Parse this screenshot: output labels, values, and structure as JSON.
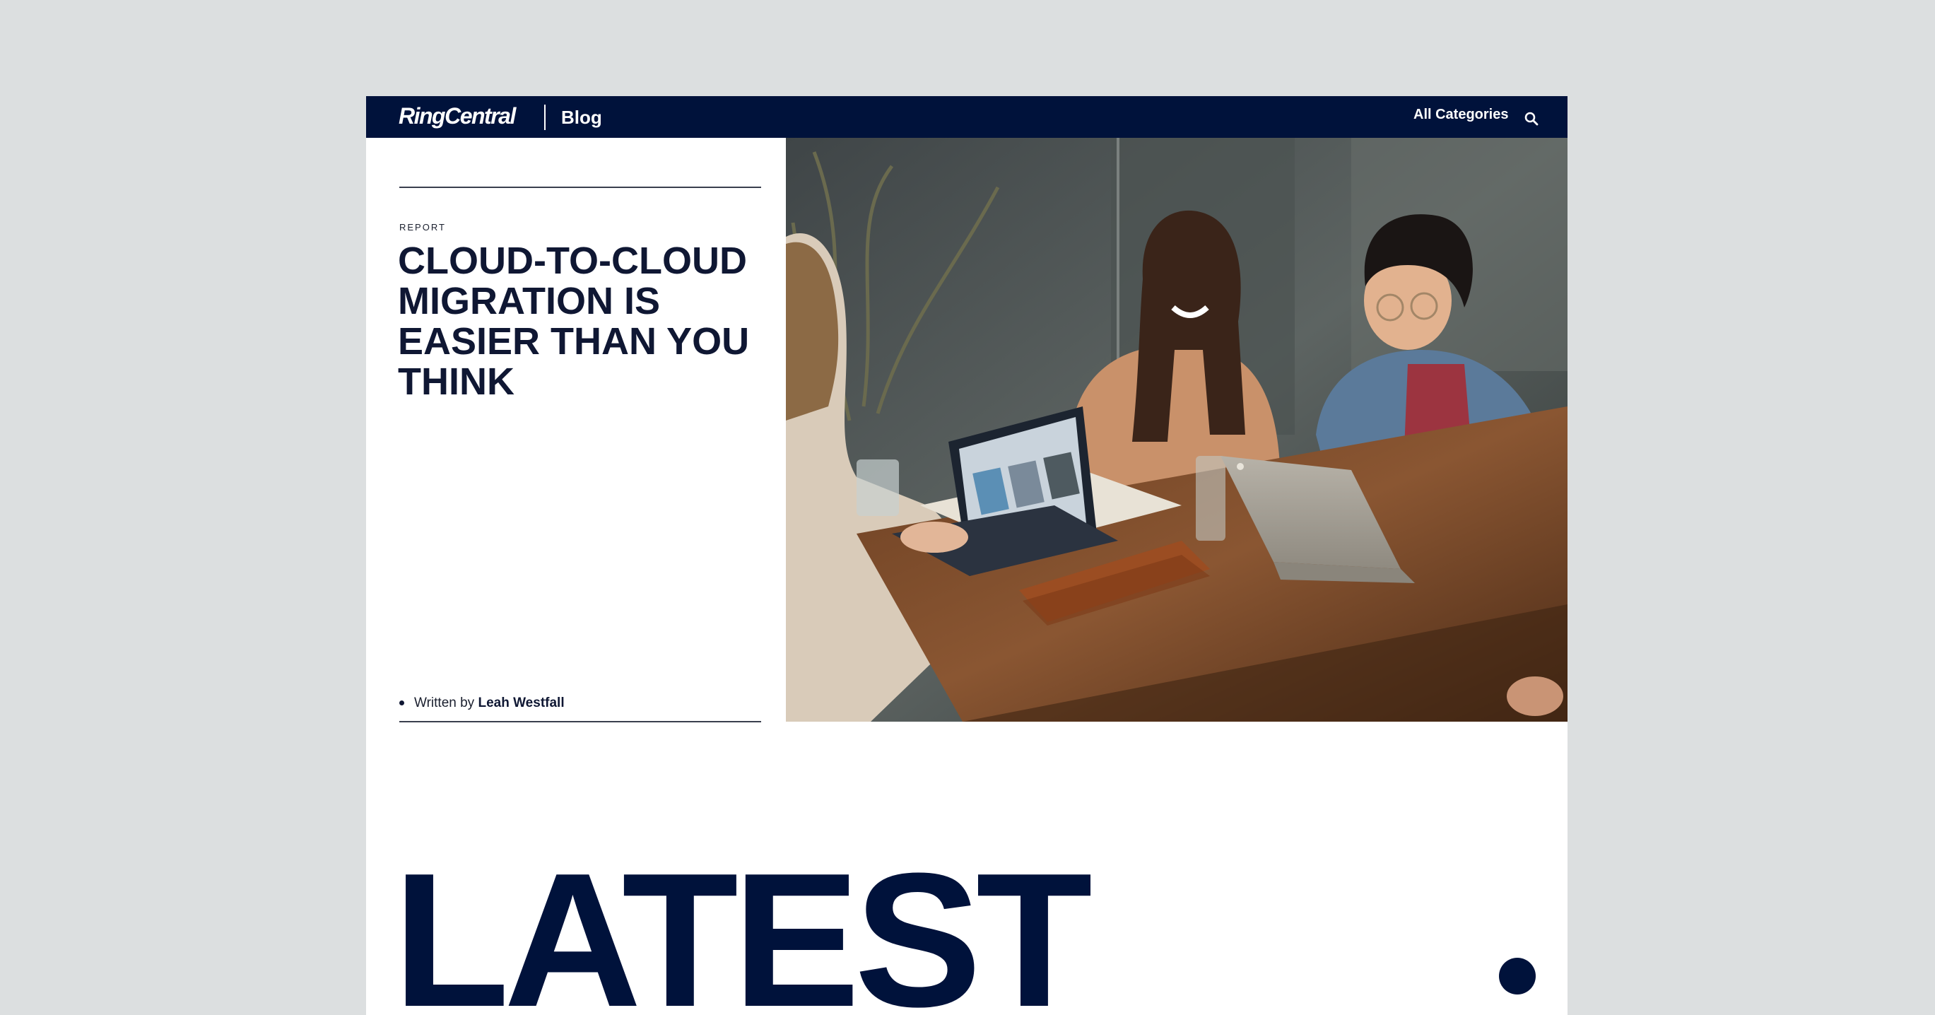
{
  "header": {
    "logo_text": "RingCentral",
    "section_label": "Blog",
    "categories_label": "All Categories",
    "search_icon": "search-icon"
  },
  "article": {
    "eyebrow": "REPORT",
    "headline": "CLOUD-TO-CLOUD MIGRATION IS EASIER THAN YOU THINK",
    "byline_prefix": "Written by",
    "author": "Leah Westfall"
  },
  "hero_image": {
    "description_icon": "photo"
  },
  "latest": {
    "heading": "LATEST"
  },
  "colors": {
    "navy": "#00123b",
    "background": "#dcdfe0"
  }
}
